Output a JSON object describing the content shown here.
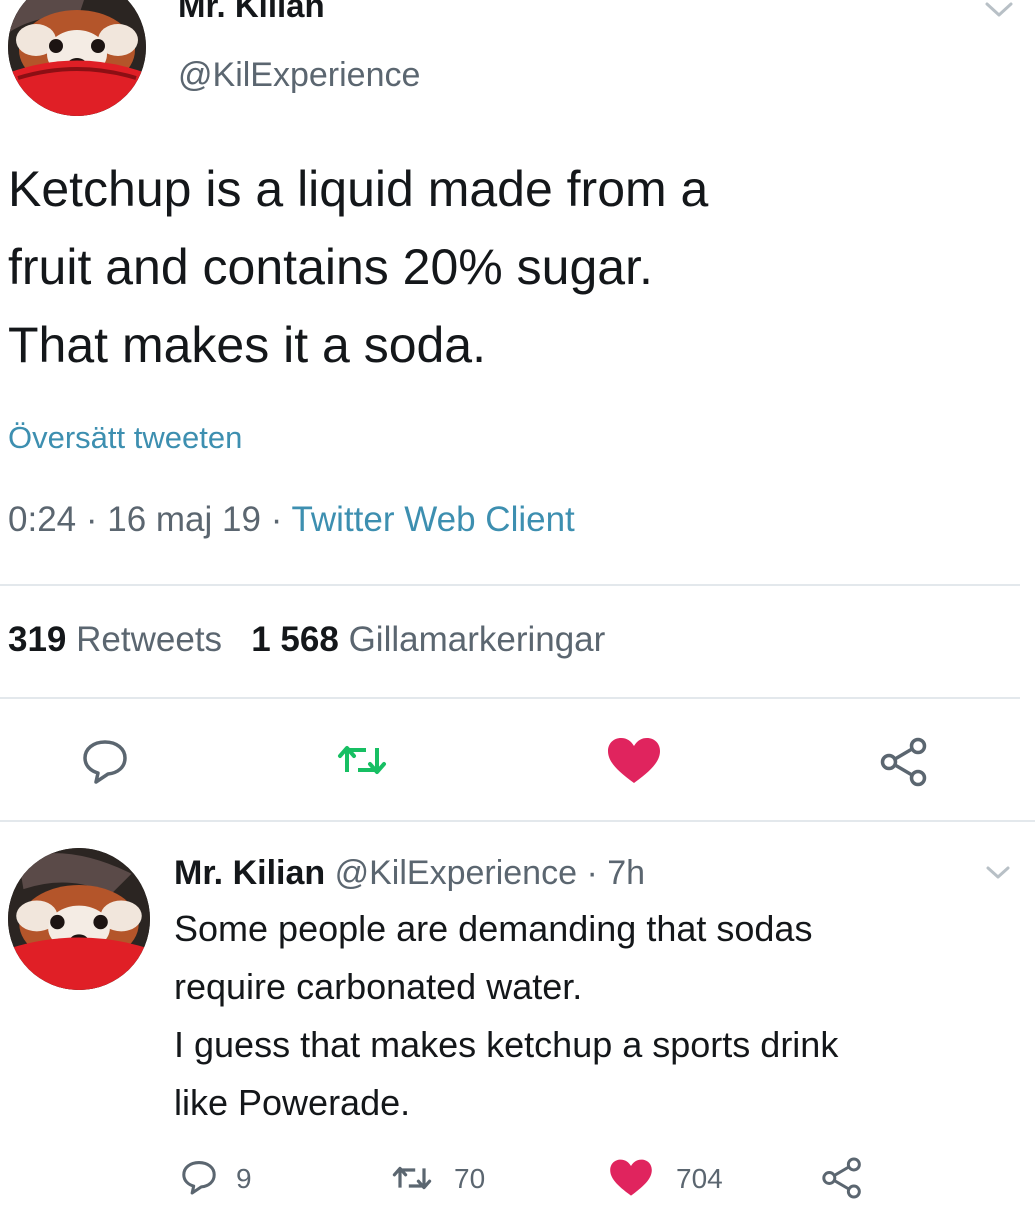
{
  "main_tweet": {
    "display_name": "Mr. Kilian",
    "handle": "@KilExperience",
    "text_lines": [
      "Ketchup is a liquid made from a",
      "fruit and contains 20% sugar.",
      "That makes it a soda."
    ],
    "translate_label": "Översätt tweeten",
    "time": "0:24",
    "date": "16 maj 19",
    "client": "Twitter Web Client",
    "retweet_count": "319",
    "retweet_label": "Retweets",
    "like_count": "1 568",
    "like_label": "Gillamarkeringar",
    "actions": [
      "reply-icon",
      "retweet-icon",
      "like-icon",
      "share-icon"
    ]
  },
  "reply_tweet": {
    "display_name": "Mr. Kilian",
    "handle": "@KilExperience",
    "age": "7h",
    "text_lines": [
      "Some people are demanding that sodas",
      "require carbonated water.",
      "I guess that makes ketchup a sports drink",
      "like Powerade."
    ],
    "reply_count": "9",
    "retweet_count": "70",
    "like_count": "704"
  },
  "colors": {
    "link": "#3d8fb0",
    "retweet": "#17bf63",
    "like": "#e0245e",
    "muted": "#5b6670",
    "text": "#14171a"
  }
}
